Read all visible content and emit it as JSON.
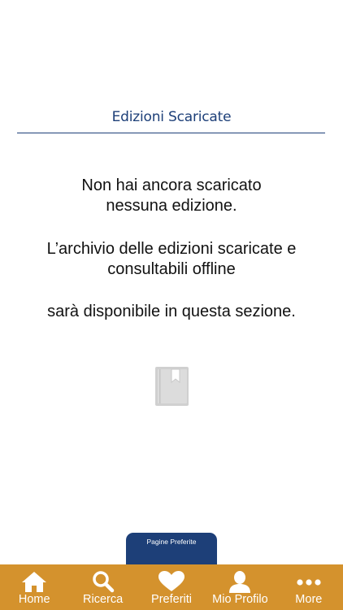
{
  "header": {
    "title": "Edizioni Scaricate"
  },
  "empty_state": {
    "line1": "Non hai ancora scaricato",
    "line2": "nessuna edizione.",
    "line3": "L’archivio delle edizioni scaricate e",
    "line4": "consultabili offline",
    "line5": "sarà disponibile in questa sezione.",
    "icon": "book-bookmark-icon"
  },
  "favorites_tab": {
    "label": "Pagine Preferite"
  },
  "tabbar": {
    "items": [
      {
        "label": "Home",
        "icon": "home-icon"
      },
      {
        "label": "Ricerca",
        "icon": "search-icon"
      },
      {
        "label": "Preferiti",
        "icon": "heart-icon"
      },
      {
        "label": "Mio Profilo",
        "icon": "profile-icon"
      },
      {
        "label": "More",
        "icon": "more-dots-icon"
      }
    ]
  },
  "colors": {
    "brand_blue": "#1d3f78",
    "tabbar_orange": "#d4922d",
    "icon_gray": "#d0d0d0"
  }
}
